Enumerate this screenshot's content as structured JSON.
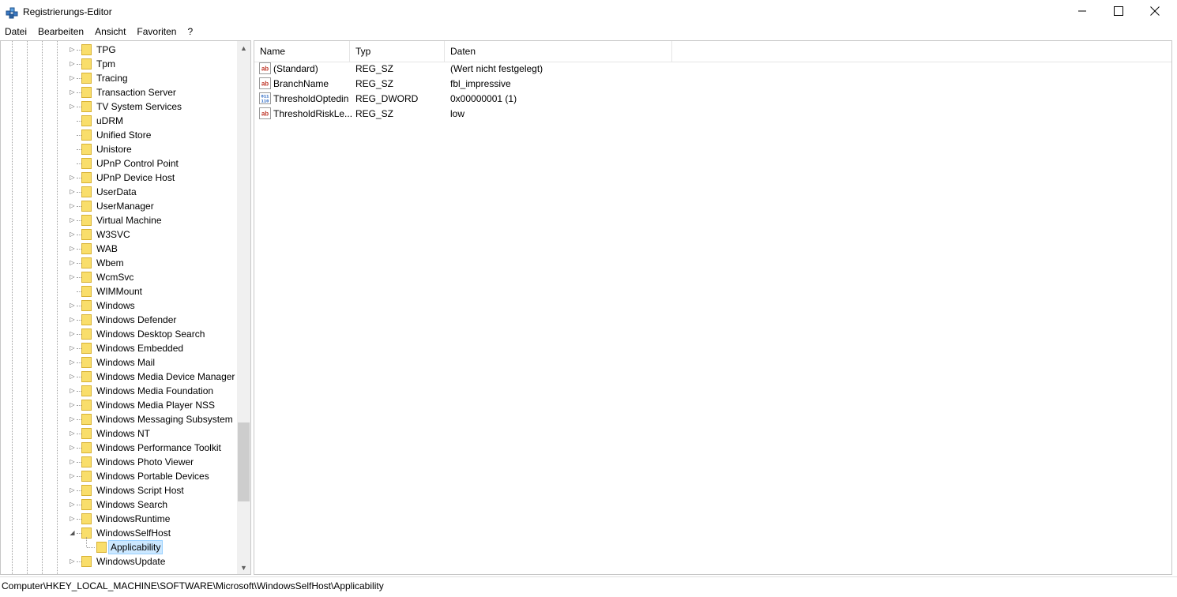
{
  "window": {
    "title": "Registrierungs-Editor",
    "icon": "registry-editor-icon"
  },
  "menu": {
    "items": [
      "Datei",
      "Bearbeiten",
      "Ansicht",
      "Favoriten",
      "?"
    ]
  },
  "tree": {
    "items": [
      {
        "label": "TPG",
        "expandable": true
      },
      {
        "label": "Tpm",
        "expandable": true
      },
      {
        "label": "Tracing",
        "expandable": true
      },
      {
        "label": "Transaction Server",
        "expandable": true
      },
      {
        "label": "TV System Services",
        "expandable": true
      },
      {
        "label": "uDRM",
        "expandable": false
      },
      {
        "label": "Unified Store",
        "expandable": false
      },
      {
        "label": "Unistore",
        "expandable": false
      },
      {
        "label": "UPnP Control Point",
        "expandable": false
      },
      {
        "label": "UPnP Device Host",
        "expandable": true
      },
      {
        "label": "UserData",
        "expandable": true
      },
      {
        "label": "UserManager",
        "expandable": true
      },
      {
        "label": "Virtual Machine",
        "expandable": true
      },
      {
        "label": "W3SVC",
        "expandable": true
      },
      {
        "label": "WAB",
        "expandable": true
      },
      {
        "label": "Wbem",
        "expandable": true
      },
      {
        "label": "WcmSvc",
        "expandable": true
      },
      {
        "label": "WIMMount",
        "expandable": false
      },
      {
        "label": "Windows",
        "expandable": true
      },
      {
        "label": "Windows Defender",
        "expandable": true
      },
      {
        "label": "Windows Desktop Search",
        "expandable": true
      },
      {
        "label": "Windows Embedded",
        "expandable": true
      },
      {
        "label": "Windows Mail",
        "expandable": true
      },
      {
        "label": "Windows Media Device Manager",
        "expandable": true
      },
      {
        "label": "Windows Media Foundation",
        "expandable": true
      },
      {
        "label": "Windows Media Player NSS",
        "expandable": true
      },
      {
        "label": "Windows Messaging Subsystem",
        "expandable": true
      },
      {
        "label": "Windows NT",
        "expandable": true
      },
      {
        "label": "Windows Performance Toolkit",
        "expandable": true
      },
      {
        "label": "Windows Photo Viewer",
        "expandable": true
      },
      {
        "label": "Windows Portable Devices",
        "expandable": true
      },
      {
        "label": "Windows Script Host",
        "expandable": true
      },
      {
        "label": "Windows Search",
        "expandable": true
      },
      {
        "label": "WindowsRuntime",
        "expandable": true
      },
      {
        "label": "WindowsSelfHost",
        "expandable": true,
        "expanded": true
      },
      {
        "label": "Applicability",
        "child": true,
        "selected": true
      },
      {
        "label": "WindowsUpdate",
        "expandable": true
      }
    ]
  },
  "values": {
    "columns": {
      "name": "Name",
      "type": "Typ",
      "data": "Daten"
    },
    "rows": [
      {
        "name": "(Standard)",
        "type": "REG_SZ",
        "data": "(Wert nicht festgelegt)",
        "icon": "string-value-icon"
      },
      {
        "name": "BranchName",
        "type": "REG_SZ",
        "data": "fbl_impressive",
        "icon": "string-value-icon"
      },
      {
        "name": "ThresholdOptedin",
        "type": "REG_DWORD",
        "data": "0x00000001 (1)",
        "icon": "binary-value-icon"
      },
      {
        "name": "ThresholdRiskLe...",
        "type": "REG_SZ",
        "data": "low",
        "icon": "string-value-icon"
      }
    ]
  },
  "status": {
    "path": "Computer\\HKEY_LOCAL_MACHINE\\SOFTWARE\\Microsoft\\WindowsSelfHost\\Applicability"
  },
  "colors": {
    "folder": "#f9de6b",
    "selection": "#cce8ff",
    "string_icon": "#c0392b",
    "binary_icon": "#1f5fbf"
  }
}
